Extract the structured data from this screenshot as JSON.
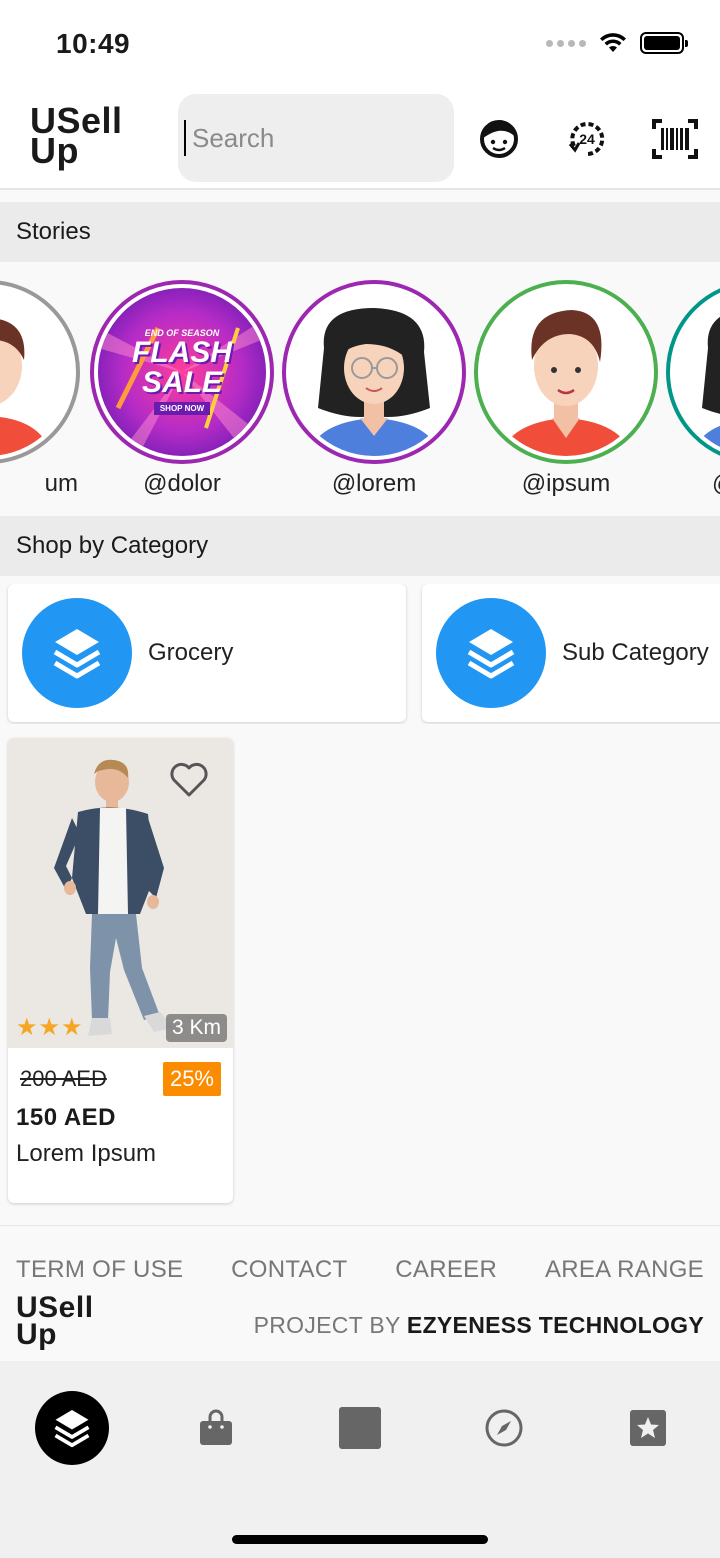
{
  "status_bar": {
    "time": "10:49"
  },
  "header": {
    "logo_line1": "USell",
    "logo_line2": "Up",
    "search_placeholder": "Search",
    "icons": [
      "support-agent-icon",
      "24-hours-icon",
      "barcode-icon"
    ]
  },
  "stories": {
    "title": "Stories",
    "items": [
      {
        "handle": "@ipsum",
        "visible_label": "um",
        "ring_color": "#795548"
      },
      {
        "handle": "@dolor",
        "visible_label": "@dolor",
        "ring_color": "#9c27b0",
        "promo": "FLASH SALE",
        "promo_top": "END OF SEASON",
        "promo_cta": "SHOP NOW"
      },
      {
        "handle": "@lorem",
        "visible_label": "@lorem",
        "ring_color": "#9c27b0"
      },
      {
        "handle": "@ipsum",
        "visible_label": "@ipsum",
        "ring_color": "#4caf50"
      },
      {
        "handle": "@",
        "visible_label": "@",
        "ring_color": "#009688"
      }
    ]
  },
  "categories": {
    "title": "Shop by Category",
    "items": [
      {
        "label": "Grocery",
        "icon": "layers-icon"
      },
      {
        "label": "Sub Category",
        "icon": "layers-icon"
      }
    ]
  },
  "products": [
    {
      "name": "Lorem Ipsum",
      "old_price": "200 AED",
      "new_price": "150 AED",
      "discount": "25%",
      "distance": "3 Km",
      "rating": 3,
      "stars": "★★★"
    }
  ],
  "footer": {
    "links": [
      "TERM OF USE",
      "CONTACT",
      "CAREER",
      "AREA RANGE"
    ],
    "logo_line1": "USell",
    "logo_line2": "Up",
    "credit_prefix": "PROJECT BY",
    "credit_company": "EZYENESS TECHNOLOGY"
  },
  "bottom_nav": {
    "items": [
      "layers-icon",
      "shopping-bag-icon",
      "square-icon",
      "compass-icon",
      "star-box-icon"
    ],
    "active_index": 0
  },
  "colors": {
    "accent_blue": "#2196f3",
    "discount_orange": "#fb8c00",
    "star_gold": "#f5a623"
  }
}
